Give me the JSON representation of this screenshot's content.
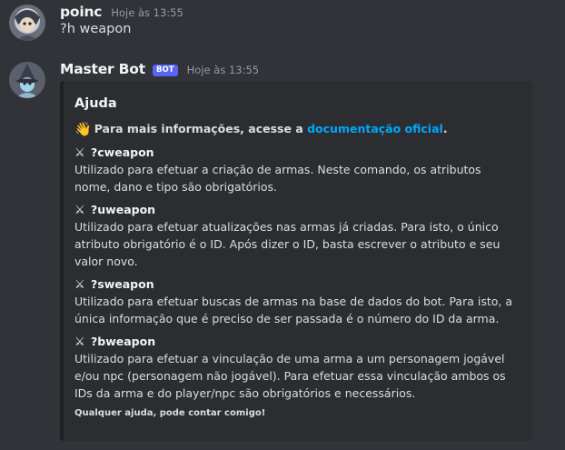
{
  "messages": [
    {
      "username": "poinc",
      "timestamp": "Hoje às 13:55",
      "content": "?h weapon",
      "avatar_icon": "hooded-character-avatar"
    },
    {
      "username": "Master Bot",
      "bot_tag": "BOT",
      "timestamp": "Hoje às 13:55",
      "avatar_icon": "wizard-avatar",
      "embed": {
        "title": "Ajuda",
        "description_prefix": "Para mais informações, acesse a ",
        "description_link": "documentação oficial",
        "description_suffix": ".",
        "wave_emoji": "👋",
        "fields": [
          {
            "icon": "⚔",
            "name": "?cweapon",
            "value": "Utilizado para efetuar a criação de armas. Neste comando, os atributos nome, dano e tipo são obrigatórios."
          },
          {
            "icon": "⚔",
            "name": "?uweapon",
            "value": "Utilizado para efetuar atualizações nas armas já criadas. Para isto, o único atributo obrigatório é o ID. Após dizer o ID, basta escrever o atributo e seu valor novo."
          },
          {
            "icon": "⚔",
            "name": "?sweapon",
            "value": "Utilizado para efetuar buscas de armas na base de dados do bot. Para isto, a única informação que é preciso de ser passada é o número do ID da arma."
          },
          {
            "icon": "⚔",
            "name": "?bweapon",
            "value": "Utilizado para efetuar a vinculação de uma arma a um personagem jogável e/ou npc (personagem não jogável). Para efetuar essa vinculação ambos os IDs da arma e do player/npc são obrigatórios e necessários."
          }
        ],
        "footer": "Qualquer ajuda, pode contar comigo!"
      }
    }
  ],
  "colors": {
    "background": "#323339",
    "embed_background": "#2b2d31",
    "embed_border": "#1e1f22",
    "link": "#00a8fc",
    "bot_tag": "#5865f2"
  }
}
